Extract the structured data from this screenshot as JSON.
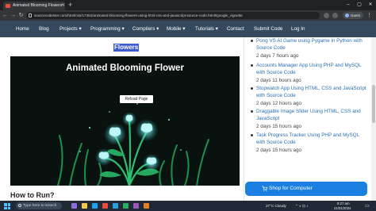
{
  "browser": {
    "tab_title": "Animated Blooming Flowers",
    "url": "sourcecodester.com/html/css/17452/animated-blooming-flowers-using-html-css-and-javascript-source-code.html#google_vignette",
    "profile_label": "Guest"
  },
  "nav": {
    "items": [
      "Home",
      "Blog",
      "Projects ▾",
      "Programming ▾",
      "Compilers ▾",
      "Mobile ▾",
      "Tutorials ▾",
      "Contact",
      "Submit Code",
      "Log In"
    ]
  },
  "article": {
    "highlight": "Flowers",
    "hero_title": "Animated Blooming Flower",
    "reload_label": "Reload Page",
    "section_heading": "How to Run?"
  },
  "sidebar": {
    "posts": [
      {
        "title": "Pong VS AI Game using Pygame in Python with Source Code",
        "date": "2 days 7 hours ago"
      },
      {
        "title": "Accounts Manager App Using PHP and MySQL with Source Code",
        "date": "2 days 11 hours ago"
      },
      {
        "title": "Stopwatch App Using HTML, CSS and JavaScript with Source Code",
        "date": "2 days 12 hours ago"
      },
      {
        "title": "Draggable Image Slider Using HTML, CSS and JavaScript",
        "date": "2 days 15 hours ago"
      },
      {
        "title": "Task Progress Tracker Using PHP and MySQL with Source Code",
        "date": "2 days 15 hours ago"
      }
    ]
  },
  "shop": {
    "label": "Shop for Computer"
  },
  "taskbar": {
    "search_placeholder": "Type here to search",
    "weather": "27°C  Cloudy",
    "time": "8:27 am",
    "date": "21/01/2024"
  },
  "colors": {
    "nav_bg": "#34495e",
    "highlight_bg": "#3b5ccc",
    "link": "#2a6fb0",
    "shop_button": "#1a7fe0",
    "flower_glow": "#8ff0f0"
  }
}
